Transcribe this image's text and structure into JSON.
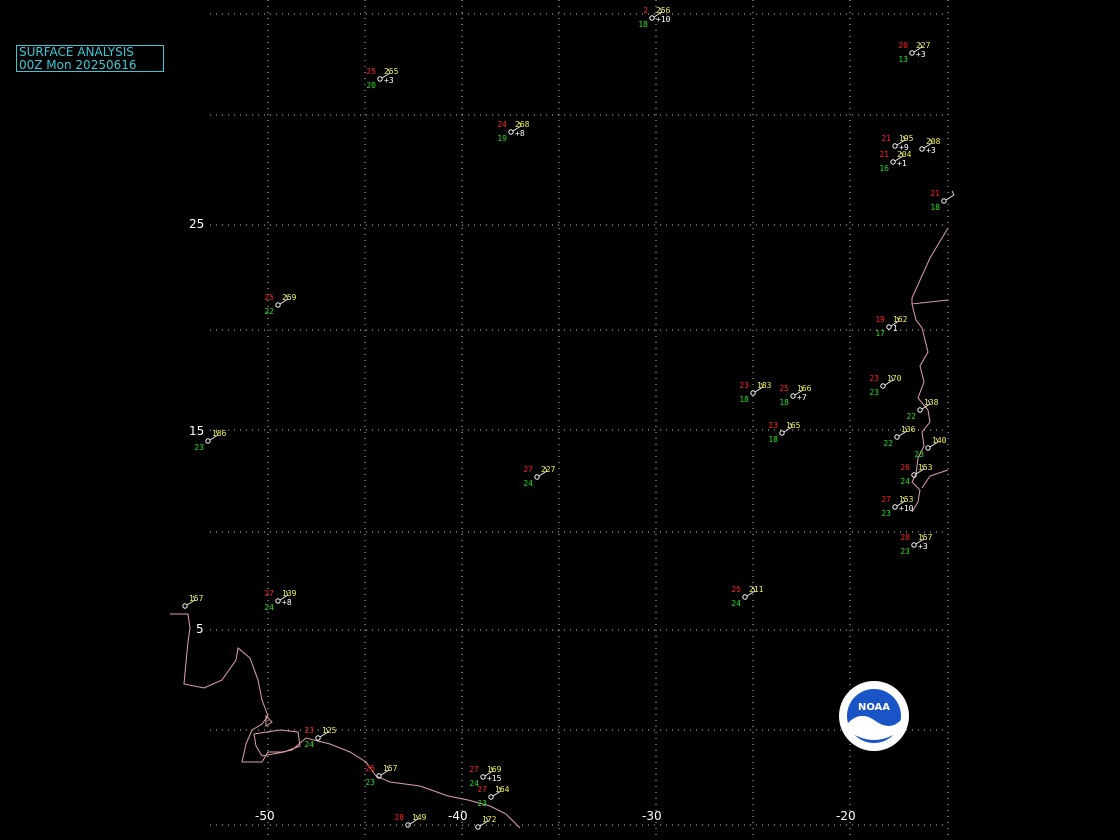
{
  "header": {
    "line1": "SURFACE ANALYSIS",
    "line2": "00Z Mon 20250616"
  },
  "logo": {
    "text": "NOAA"
  },
  "colors": {
    "background": "#000000",
    "grid": "#c8c8c8",
    "coast": "#e0a0a8",
    "temperature": "#ff2020",
    "dewpoint": "#20e020",
    "pressure": "#f0f040",
    "title": "#3cc8d8",
    "label": "#ffffff"
  },
  "axes": {
    "lon_labels": [
      "-50",
      "-40",
      "-30",
      "-20"
    ],
    "lat_labels": [
      "25",
      "15",
      "5"
    ]
  },
  "stations": [
    {
      "t": "2",
      "td": "18",
      "p": "256",
      "tend": "+10"
    },
    {
      "t": "20",
      "td": "13",
      "p": "227",
      "tend": "+3"
    },
    {
      "t": "25",
      "td": "20",
      "p": "255",
      "tend": "+3"
    },
    {
      "t": "24",
      "td": "19",
      "p": "268",
      "tend": "+8"
    },
    {
      "t": "21",
      "td": "",
      "p": "195",
      "tend": "+9"
    },
    {
      "t": "",
      "td": "",
      "p": "208",
      "tend": "+3"
    },
    {
      "t": "21",
      "td": "16",
      "p": "204",
      "tend": "+1"
    },
    {
      "t": "21",
      "td": "18",
      "p": "",
      "tend": ""
    },
    {
      "t": "25",
      "td": "22",
      "p": "259",
      "tend": ""
    },
    {
      "t": "19",
      "td": "17",
      "p": "162",
      "tend": "1"
    },
    {
      "t": "23",
      "td": "18",
      "p": "183",
      "tend": ""
    },
    {
      "t": "25",
      "td": "18",
      "p": "166",
      "tend": "+7"
    },
    {
      "t": "23",
      "td": "23",
      "p": "170",
      "tend": ""
    },
    {
      "t": "",
      "td": "22",
      "p": "138",
      "tend": ""
    },
    {
      "t": "23",
      "td": "18",
      "p": "165",
      "tend": ""
    },
    {
      "t": "",
      "td": "22",
      "p": "136",
      "tend": ""
    },
    {
      "t": "",
      "td": "23",
      "p": "140",
      "tend": ""
    },
    {
      "t": "",
      "td": "23",
      "p": "186",
      "tend": ""
    },
    {
      "t": "27",
      "td": "24",
      "p": "227",
      "tend": ""
    },
    {
      "t": "26",
      "td": "24",
      "p": "153",
      "tend": ""
    },
    {
      "t": "27",
      "td": "23",
      "p": "153",
      "tend": "+10"
    },
    {
      "t": "28",
      "td": "23",
      "p": "157",
      "tend": "+3"
    },
    {
      "t": "25",
      "td": "24",
      "p": "211",
      "tend": ""
    },
    {
      "t": "27",
      "td": "24",
      "p": "139",
      "tend": "+8"
    },
    {
      "t": "",
      "td": "",
      "p": "157",
      "tend": ""
    },
    {
      "t": "23",
      "td": "24",
      "p": "125",
      "tend": ""
    },
    {
      "t": "26",
      "td": "23",
      "p": "157",
      "tend": ""
    },
    {
      "t": "27",
      "td": "24",
      "p": "169",
      "tend": "+15"
    },
    {
      "t": "27",
      "td": "23",
      "p": "164",
      "tend": ""
    },
    {
      "t": "28",
      "td": "",
      "p": "149",
      "tend": ""
    },
    {
      "t": "",
      "td": "",
      "p": "172",
      "tend": ""
    }
  ]
}
